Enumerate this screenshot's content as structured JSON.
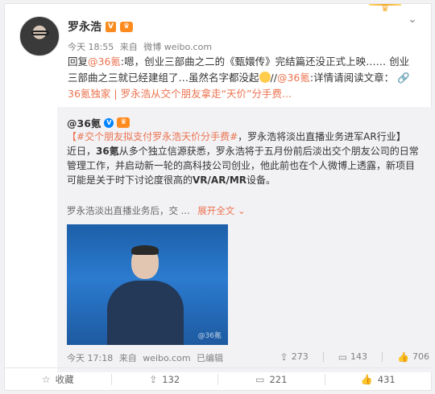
{
  "author": {
    "name": "罗永浩",
    "verified_badge": "V"
  },
  "meta": {
    "time": "今天 18:55",
    "source_prefix": "来自",
    "source": "微博 weibo.com"
  },
  "post": {
    "reply_prefix": "回复",
    "mention": "@36氪",
    "text1": ":嗯，创业三部曲之二的《甄嬛传》完结篇还没正式上映…… 创业三部曲之三就已经建组了…虽然名字都没起",
    "sep": "//",
    "mention2": "@36氪",
    "text2": ":详情请阅读文章：",
    "link_text": "36氪独家 | 罗永浩从交个朋友拿走“天价”分手费..."
  },
  "quote": {
    "author": "@36氪",
    "hashtag": "#交个朋友拟支付罗永浩天价分手费#",
    "headline": "，罗永浩将淡出直播业务进军AR行业】",
    "bracket_open": "【",
    "body_pre": "近日，",
    "body_bold": "36氪",
    "body1": "从多个独立信源获悉，罗永浩将于五月份前后淡出交个朋友公司的日常管理工作，并启动新一轮的高科技公司创业，他此前也在个人微博上透露，新项目可能是关于时下讨论度很高的",
    "body_bold2": "VR/AR/MR",
    "body2": "设备。",
    "summary": "罗永浩淡出直播业务后，交 ...",
    "expand": "展开全文",
    "time": "今天 17:18",
    "source_prefix": "来自",
    "source": "weibo.com",
    "edited": "已编辑",
    "repost_count": "273",
    "comment_count": "143",
    "like_count": "706",
    "photo_watermark": "@36氪"
  },
  "actions": {
    "favorite": "收藏",
    "repost": "132",
    "comment": "221",
    "like": "431"
  },
  "colors": {
    "accent": "#eb7350",
    "meta_gray": "#808080",
    "quote_bg": "#f2f2f5"
  }
}
